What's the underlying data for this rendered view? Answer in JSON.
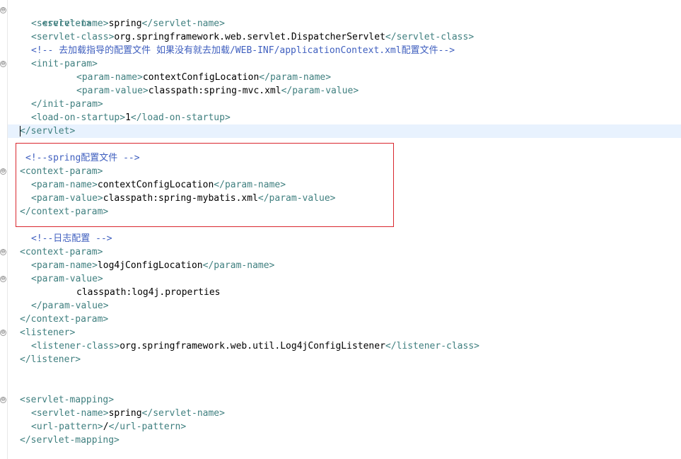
{
  "lines": [
    {
      "tag_open": "<servlet>"
    },
    {
      "a": "<servlet-name>",
      "t": "spring",
      "b": "</servlet-name>"
    },
    {
      "a": "<servlet-class>",
      "t": "org.springframework.web.servlet.DispatcherServlet",
      "b": "</servlet-class>"
    },
    {
      "comment": "<!-- 去加载指导的配置文件 如果没有就去加载/WEB-INF/applicationContext.xml配置文件-->"
    },
    {
      "tag_open": "<init-param>"
    },
    {
      "a": "<param-name>",
      "t": "contextConfigLocation",
      "b": "</param-name>"
    },
    {
      "a": "<param-value>",
      "t": "classpath:spring-mvc.xml",
      "b": "</param-value>"
    },
    {
      "tag_open": "</init-param>"
    },
    {
      "a": "<load-on-startup>",
      "t": "1",
      "b": "</load-on-startup>"
    },
    {
      "tag_open": "</servlet>"
    },
    {
      "comment": "<!--spring配置文件 -->"
    },
    {
      "tag_open": "<context-param>"
    },
    {
      "a": "<param-name>",
      "t": "contextConfigLocation",
      "b": "</param-name>"
    },
    {
      "a": "<param-value>",
      "t": "classpath:spring-mybatis.xml",
      "b": "</param-value>"
    },
    {
      "tag_open": "</context-param>"
    },
    {
      "comment": "<!--日志配置 -->"
    },
    {
      "tag_open": "<context-param>"
    },
    {
      "a": "<param-name>",
      "t": "log4jConfigLocation",
      "b": "</param-name>"
    },
    {
      "tag_open": "<param-value>"
    },
    {
      "text": "classpath:log4j.properties"
    },
    {
      "tag_open": "</param-value>"
    },
    {
      "tag_open": "</context-param>"
    },
    {
      "tag_open": "<listener>"
    },
    {
      "a": "<listener-class>",
      "t": "org.springframework.web.util.Log4jConfigListener",
      "b": "</listener-class>"
    },
    {
      "tag_open": "</listener>"
    },
    {
      "tag_open": "<servlet-mapping>"
    },
    {
      "a": "<servlet-name>",
      "t": "spring",
      "b": "</servlet-name>"
    },
    {
      "a": "<url-pattern>",
      "t": "/",
      "b": "</url-pattern>"
    },
    {
      "tag_open": "</servlet-mapping>"
    }
  ],
  "fold_marker": "⊖",
  "colors": {
    "tag": "#3f7f7f",
    "comment": "#3f5fbf",
    "text": "#000000",
    "highlight_box": "#d9272e",
    "current_line": "#e8f2fe"
  }
}
